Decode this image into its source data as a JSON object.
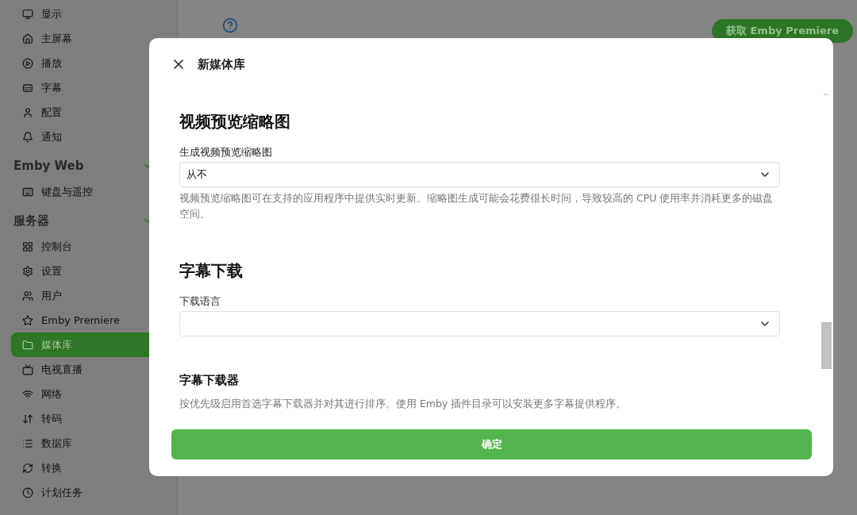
{
  "sidebar": {
    "items": [
      {
        "kind": "item",
        "label": "显示",
        "selected": false
      },
      {
        "kind": "item",
        "label": "主屏幕",
        "selected": false
      },
      {
        "kind": "item",
        "label": "播放",
        "selected": false
      },
      {
        "kind": "item",
        "label": "字幕",
        "selected": false
      },
      {
        "kind": "item",
        "label": "配置",
        "selected": false
      },
      {
        "kind": "item",
        "label": "通知",
        "selected": false
      },
      {
        "kind": "header",
        "label": "Emby Web"
      },
      {
        "kind": "item",
        "label": "键盘与遥控",
        "selected": false
      },
      {
        "kind": "header",
        "label": "服务器"
      },
      {
        "kind": "item",
        "label": "控制台",
        "selected": false
      },
      {
        "kind": "item",
        "label": "设置",
        "selected": false
      },
      {
        "kind": "item",
        "label": "用户",
        "selected": false
      },
      {
        "kind": "item",
        "label": "Emby Premiere",
        "selected": false
      },
      {
        "kind": "item",
        "label": "媒体库",
        "selected": true
      },
      {
        "kind": "item",
        "label": "电视直播",
        "selected": false
      },
      {
        "kind": "item",
        "label": "网络",
        "selected": false
      },
      {
        "kind": "item",
        "label": "转码",
        "selected": false
      },
      {
        "kind": "item",
        "label": "数据库",
        "selected": false
      },
      {
        "kind": "item",
        "label": "转换",
        "selected": false
      },
      {
        "kind": "item",
        "label": "计划任务",
        "selected": false
      }
    ]
  },
  "topbar": {
    "premium_button": "获取 Emby Premiere"
  },
  "dialog": {
    "title": "新媒体库",
    "content": [
      {
        "kind": "heading",
        "text": "视频预览缩略图"
      },
      {
        "kind": "select",
        "label": "生成视频预览缩略图",
        "value": "从不",
        "description": "视频预览缩略图可在支持的应用程序中提供实时更新。缩略图生成可能会花费很长时间，导致较高的 CPU 使用率并消耗更多的磁盘空间。"
      },
      {
        "kind": "heading",
        "text": "字幕下载"
      },
      {
        "kind": "select",
        "label": "下载语言"
      },
      {
        "kind": "subheading",
        "text": "字幕下载器"
      },
      {
        "kind": "paragraph",
        "text": "按优先级启用首选字幕下载器并对其进行排序。使用 Emby 插件目录可以安装更多字幕提供程序。"
      }
    ],
    "confirm_button": "确定"
  }
}
